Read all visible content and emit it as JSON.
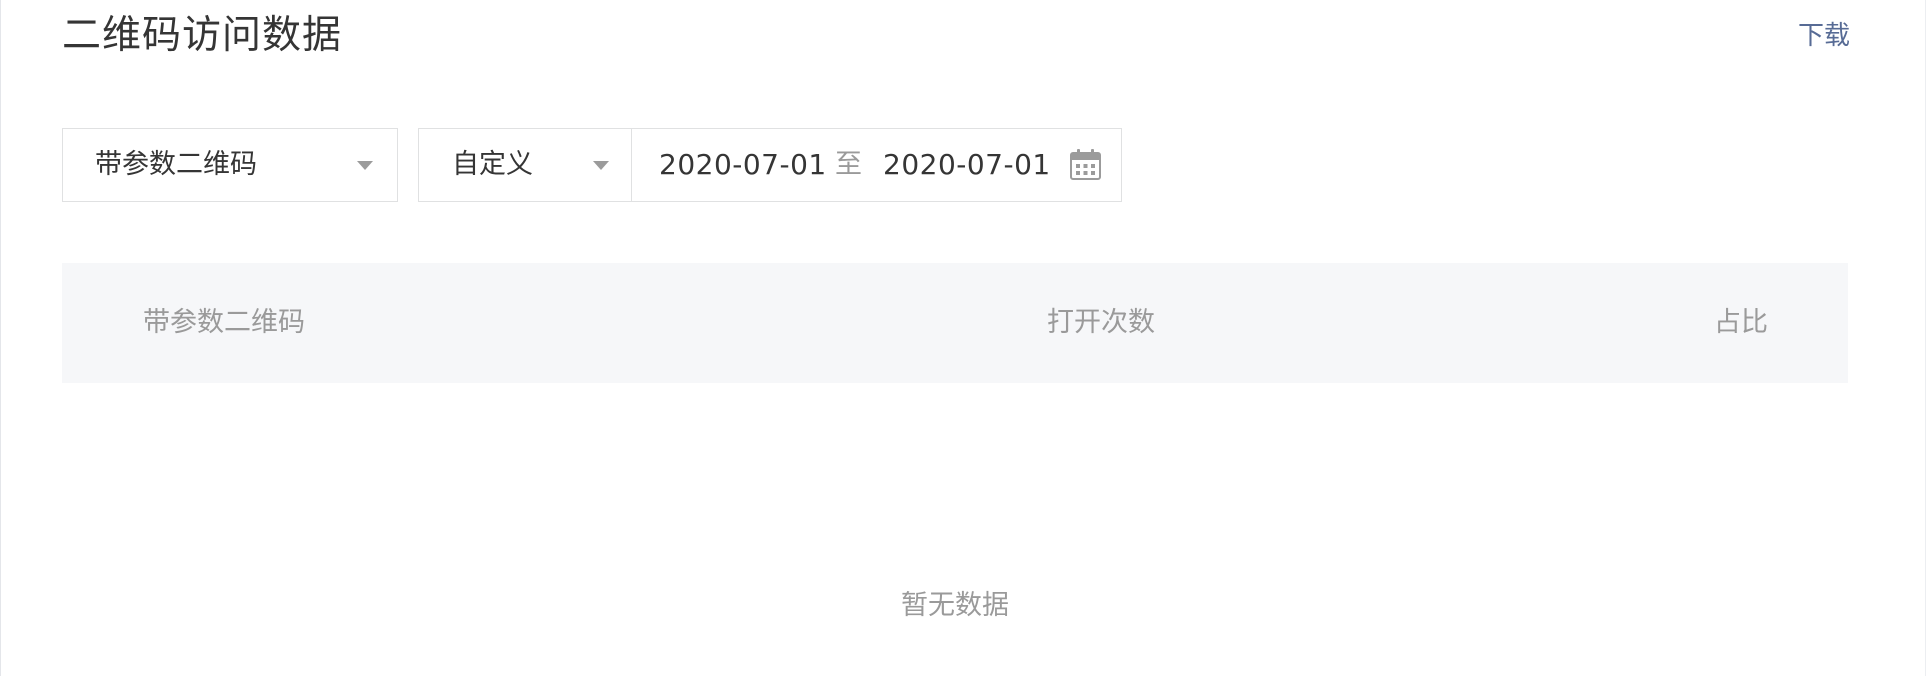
{
  "header": {
    "title": "二维码访问数据",
    "download_label": "下载"
  },
  "filters": {
    "type_select": {
      "selected": "带参数二维码"
    },
    "range_select": {
      "selected": "自定义"
    },
    "date_range": {
      "start": "2020-07-01",
      "separator": "至",
      "end": "2020-07-01",
      "icon": "calendar-icon"
    }
  },
  "table": {
    "columns": [
      "带参数二维码",
      "打开次数",
      "占比"
    ],
    "rows": [],
    "empty_text": "暂无数据"
  },
  "colors": {
    "link": "#576b95",
    "text": "#353535",
    "muted": "#9a9a9a",
    "header_bg": "#f6f7f9",
    "border": "#e0e1e2"
  }
}
